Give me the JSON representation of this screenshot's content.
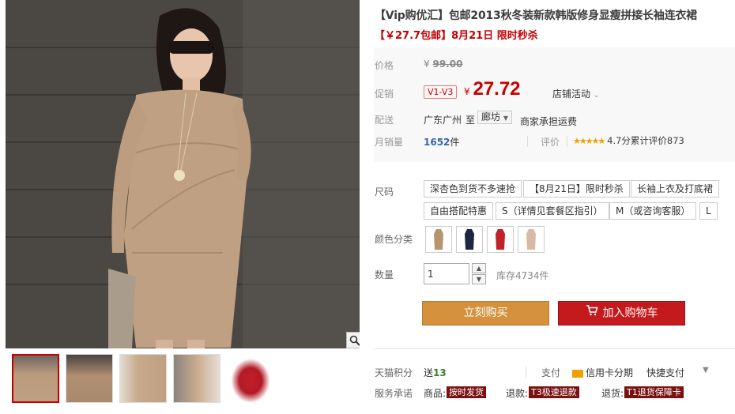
{
  "product": {
    "title": "【Vip购优汇】包邮2013秋冬装新款韩版修身显瘦拼接长袖连衣裙",
    "subtitle": "【￥27.7包邮】8月21日 限时秒杀"
  },
  "price": {
    "label": "价格",
    "currency": "¥",
    "original": "99.00"
  },
  "promo": {
    "label": "促销",
    "vip_tag": "V1-V3",
    "currency": "¥",
    "price": "27.72",
    "shop_activity": "店铺活动"
  },
  "delivery": {
    "label": "配送",
    "from": "广东广州",
    "to_word": "至",
    "to_city": "廊坊",
    "shipping": "商家承担运费"
  },
  "sales": {
    "label": "月销量",
    "count": "1652",
    "unit": "件",
    "rating_label": "评价",
    "stars": "★★★★★",
    "rating_text": "4.7分累计评价873"
  },
  "sizes": {
    "label": "尺码",
    "options": [
      "深杏色到货不多速抢",
      "【8月21日】限时秒杀",
      "长袖上衣及打底裙",
      "自由搭配特惠",
      "S（详情见套餐区指引）",
      "M（或咨询客服）",
      "L"
    ]
  },
  "colors": {
    "label": "颜色分类",
    "swatches": [
      {
        "name": "camel",
        "color": "#b8946e"
      },
      {
        "name": "navy",
        "color": "#1d2540"
      },
      {
        "name": "red",
        "color": "#c0222a"
      },
      {
        "name": "beige",
        "color": "#d9b9a6"
      }
    ]
  },
  "quantity": {
    "label": "数量",
    "value": "1",
    "stock": "库存4734件"
  },
  "buttons": {
    "buy_now": "立刻购买",
    "add_to_cart": "加入购物车"
  },
  "footer": {
    "points_label": "天猫积分",
    "points_prefix": "送",
    "points_value": "13",
    "pay_label": "支付",
    "credit_card": "信用卡分期",
    "quick_pay": "快捷支付",
    "service_label": "服务承诺",
    "goods_label": "商品:",
    "goods_badge": "按时发货",
    "refund_label": "退款:",
    "refund_badge": "T3极速退款",
    "return_label": "退货:",
    "return_badge": "T1退货保障卡"
  },
  "icons": {
    "zoom": "magnifier-icon",
    "cart": "cart-icon",
    "chevron": "chevron-down-icon",
    "card": "credit-card-icon"
  },
  "colors_theme": {
    "accent_red": "#c40000",
    "buy_orange": "#d5913b",
    "cart_red": "#c4191d"
  }
}
